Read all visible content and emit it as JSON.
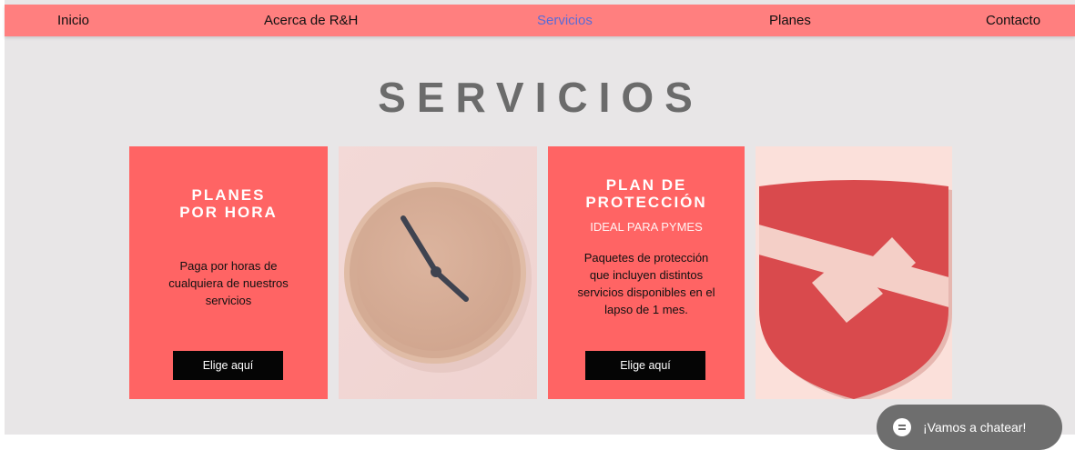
{
  "nav": {
    "items": [
      {
        "label": "Inicio"
      },
      {
        "label": "Acerca de R&H"
      },
      {
        "label": "Servicios"
      },
      {
        "label": "Planes"
      },
      {
        "label": "Contacto"
      }
    ],
    "active": "Servicios"
  },
  "page": {
    "title": "SERVICIOS"
  },
  "cards": [
    {
      "title_line1": "PLANES",
      "title_line2": "POR HORA",
      "description_lines": [
        "Paga por horas de",
        "cualquiera de nuestros",
        "servicios"
      ],
      "button": "Elige aquí"
    },
    {
      "title_line1": "PLAN DE",
      "title_line2": "PROTECCIÓN",
      "subtitle": "IDEAL PARA PYMES",
      "description_lines": [
        "Paquetes de protección",
        "que incluyen distintos",
        "servicios disponibles en el",
        "lapso de 1 mes."
      ],
      "button": "Elige aquí"
    }
  ],
  "images": {
    "clock": "clock-icon",
    "shield": "shield-check-icon"
  },
  "chat": {
    "label": "¡Vamos a chatear!",
    "icon": "chat-bubble-icon"
  },
  "colors": {
    "nav_bg": "#ff7f7f",
    "card_red": "#ff6464",
    "page_bg": "#e8e6e7",
    "active_link": "#5a6bd6",
    "button_bg": "#050505",
    "title_gray": "#6b6b6b"
  }
}
